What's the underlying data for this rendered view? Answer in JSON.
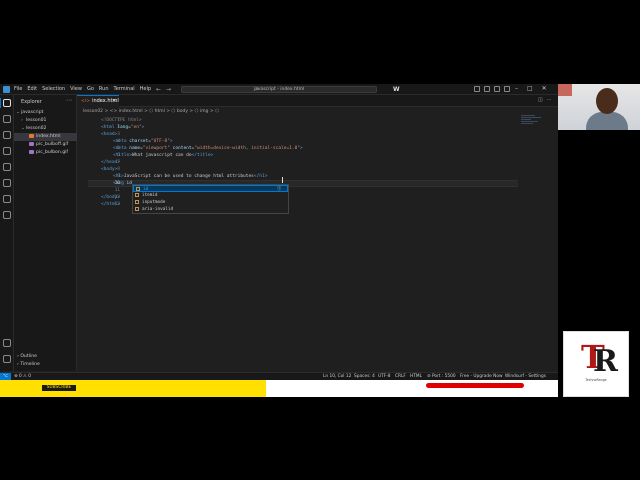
{
  "window": {
    "search_text": "javascript - index.html",
    "menus": [
      "File",
      "Edit",
      "Selection",
      "View",
      "Go",
      "Run",
      "Terminal",
      "Help"
    ],
    "brand_logo": "W"
  },
  "sidebar": {
    "title": "Explorer",
    "items": [
      {
        "label": "javascript",
        "type": "folder-open",
        "depth": 0
      },
      {
        "label": "lesson01",
        "type": "folder",
        "depth": 1
      },
      {
        "label": "lesson02",
        "type": "folder-open",
        "depth": 1
      },
      {
        "label": "index.html",
        "type": "html",
        "depth": 2,
        "selected": true
      },
      {
        "label": "pic_bulboff.gif",
        "type": "image",
        "depth": 2
      },
      {
        "label": "pic_bulbon.gif",
        "type": "image",
        "depth": 2
      }
    ],
    "outline": "Outline",
    "timeline": "Timeline"
  },
  "tab": {
    "label": "index.html"
  },
  "breadcrumb": "lesson02 > <> index.html > ⬡ html > ⬡ body > ⬡ img > ⬡",
  "editor": {
    "line_numbers": [
      "1",
      "2",
      "3",
      "4",
      "5",
      "6",
      "7",
      "8",
      "9",
      "10",
      "11",
      "12",
      "13"
    ],
    "current_line": "10",
    "lines": {
      "l1_doctype": "<!DOCTYPE html>",
      "l2_open": "<html ",
      "l2_attr": "lang",
      "l2_val": "\"en\"",
      "l2_close": ">",
      "l3": "<head>",
      "l4_open": "<meta ",
      "l4_attr": "charset",
      "l4_val": "\"UTF-8\"",
      "l4_close": ">",
      "l5_open": "<meta ",
      "l5_a1": "name",
      "l5_v1": "\"viewport\"",
      "l5_a2": " content",
      "l5_v2": "\"width=device-width, initial-scale=1.0\"",
      "l5_close": ">",
      "l6_open": "<title>",
      "l6_text": "What javascript can do",
      "l6_close": "</title>",
      "l7": "</head>",
      "l8": "<body>",
      "l9_open": "<h1>",
      "l9_text": "JavaScript can be used to change html attributes",
      "l9_close": "</h1>",
      "l10_tag": "<img ",
      "l10_typed": "id",
      "l12": "</body>",
      "l13": "</html>"
    }
  },
  "suggestions": [
    {
      "label": "id",
      "selected": true,
      "detail": "⓵"
    },
    {
      "label": "itemid",
      "selected": false
    },
    {
      "label": "inputmode",
      "selected": false
    },
    {
      "label": "aria-invalid",
      "selected": false
    }
  ],
  "statusbar": {
    "problems": "⊗ 0 ⚠ 0",
    "position": "Ln 10, Col 12",
    "spaces": "Spaces: 4",
    "encoding": "UTF-8",
    "eol": "CRLF",
    "language": "HTML",
    "port": "⊘ Port : 5500",
    "upgrade": "Free - Upgrade Now",
    "settings": "Windsurf - Settings"
  },
  "overlay": {
    "subscribe": "SUBSCRIBE"
  },
  "logo": {
    "letters": [
      "T",
      "R"
    ],
    "caption": "TechnoRange"
  },
  "colors": {
    "accent": "#0078d4",
    "tag": "#569cd6",
    "attribute": "#9cdcfe",
    "string": "#ce9178",
    "banner_yellow": "#ffe000",
    "banner_red": "#e00000",
    "logo_red": "#b01818"
  }
}
